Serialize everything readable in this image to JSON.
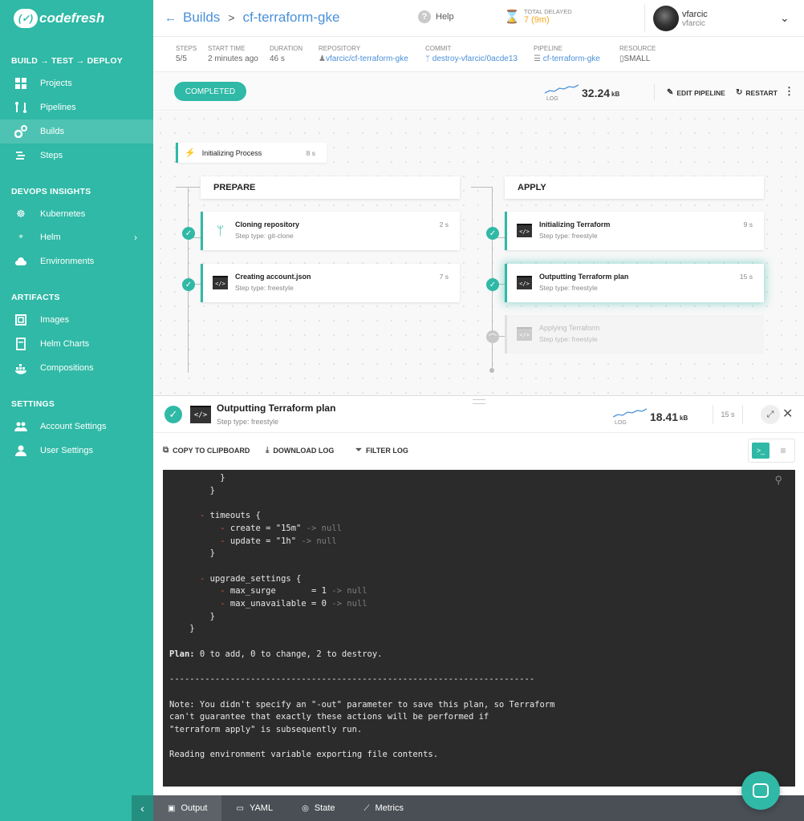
{
  "brand": {
    "logo_text": "codefresh"
  },
  "sidebar": {
    "sections": [
      {
        "title": "BUILD → TEST → DEPLOY"
      },
      {
        "title": "DEVOPS INSIGHTS"
      },
      {
        "title": "ARTIFACTS"
      },
      {
        "title": "SETTINGS"
      }
    ],
    "items": [
      {
        "label": "Projects",
        "icon": "projects-icon"
      },
      {
        "label": "Pipelines",
        "icon": "pipelines-icon"
      },
      {
        "label": "Builds",
        "icon": "builds-icon",
        "active": true
      },
      {
        "label": "Steps",
        "icon": "steps-icon"
      },
      {
        "label": "Kubernetes",
        "icon": "kubernetes-icon"
      },
      {
        "label": "Helm",
        "icon": "helm-icon"
      },
      {
        "label": "Environments",
        "icon": "cloud-icon"
      },
      {
        "label": "Images",
        "icon": "images-icon"
      },
      {
        "label": "Helm Charts",
        "icon": "helm-charts-icon"
      },
      {
        "label": "Compositions",
        "icon": "docker-icon"
      },
      {
        "label": "Account Settings",
        "icon": "account-icon"
      },
      {
        "label": "User Settings",
        "icon": "user-icon"
      }
    ]
  },
  "header": {
    "crumb_root": "Builds",
    "crumb_current": "cf-terraform-gke",
    "help": "Help",
    "delay_label": "TOTAL DELAYED",
    "delay_value": "7 (9m)",
    "user_name": "vfarcic",
    "user_login": "vfarcic"
  },
  "info": {
    "steps_k": "STEPS",
    "steps_v": "5/5",
    "start_k": "START TIME",
    "start_v": "2 minutes ago",
    "duration_k": "DURATION",
    "duration_v": "46 s",
    "repo_k": "REPOSITORY",
    "repo_v": "vfarcic/cf-terraform-gke",
    "commit_k": "COMMIT",
    "commit_v": "destroy-vfarcic/0acde13",
    "pipeline_k": "PIPELINE",
    "pipeline_v": "cf-terraform-gke",
    "resource_k": "RESOURCE",
    "resource_v": "SMALL"
  },
  "status": {
    "badge": "COMPLETED",
    "log_label": "LOG",
    "log_value": "32.24",
    "log_unit": "kB",
    "edit": "EDIT PIPELINE",
    "restart": "RESTART"
  },
  "pipeline": {
    "init": {
      "name": "Initializing Process",
      "time": "8 s"
    },
    "stages": [
      {
        "title": "PREPARE",
        "steps": [
          {
            "name": "Cloning repository",
            "type": "Step type: git-clone",
            "time": "2 s"
          },
          {
            "name": "Creating account.json",
            "type": "Step type: freestyle",
            "time": "7 s"
          }
        ]
      },
      {
        "title": "APPLY",
        "steps": [
          {
            "name": "Initializing Terraform",
            "type": "Step type: freestyle",
            "time": "9 s"
          },
          {
            "name": "Outputting Terraform plan",
            "type": "Step type: freestyle",
            "time": "15 s"
          },
          {
            "name": "Applying Terraform",
            "type": "Step type: freestyle",
            "time": ""
          }
        ]
      }
    ]
  },
  "panel": {
    "title": "Outputting Terraform plan",
    "type": "Step type: freestyle",
    "log_label": "LOG",
    "log_value": "18.41",
    "log_unit": "kB",
    "time": "15 s",
    "copy": "COPY TO CLIPBOARD",
    "download": "DOWNLOAD LOG",
    "filter": "FILTER LOG"
  },
  "terminal": {
    "lines": [
      {
        "text": "          }"
      },
      {
        "text": "        }"
      },
      {
        "text": ""
      },
      {
        "prefix": "      - ",
        "text": "timeouts {"
      },
      {
        "prefix": "          - ",
        "text": "create = \"15m\"",
        "suffix": " -> null"
      },
      {
        "prefix": "          - ",
        "text": "update = \"1h\"",
        "suffix": " -> null"
      },
      {
        "text": "        }"
      },
      {
        "text": ""
      },
      {
        "prefix": "      - ",
        "text": "upgrade_settings {"
      },
      {
        "prefix": "          - ",
        "text": "max_surge       = 1",
        "suffix": " -> null"
      },
      {
        "prefix": "          - ",
        "text": "max_unavailable = 0",
        "suffix": " -> null"
      },
      {
        "text": "        }"
      },
      {
        "text": "    }"
      },
      {
        "text": ""
      },
      {
        "bold": "Plan:",
        "text": " 0 to add, 0 to change, 2 to destroy."
      },
      {
        "text": ""
      },
      {
        "text": "------------------------------------------------------------------------"
      },
      {
        "text": ""
      },
      {
        "text": "Note: You didn't specify an \"-out\" parameter to save this plan, so Terraform"
      },
      {
        "text": "can't guarantee that exactly these actions will be performed if"
      },
      {
        "text": "\"terraform apply\" is subsequently run."
      },
      {
        "text": ""
      },
      {
        "text": "Reading environment variable exporting file contents."
      }
    ]
  },
  "tabs": [
    {
      "label": "Output",
      "active": true
    },
    {
      "label": "YAML"
    },
    {
      "label": "State"
    },
    {
      "label": "Metrics"
    }
  ]
}
